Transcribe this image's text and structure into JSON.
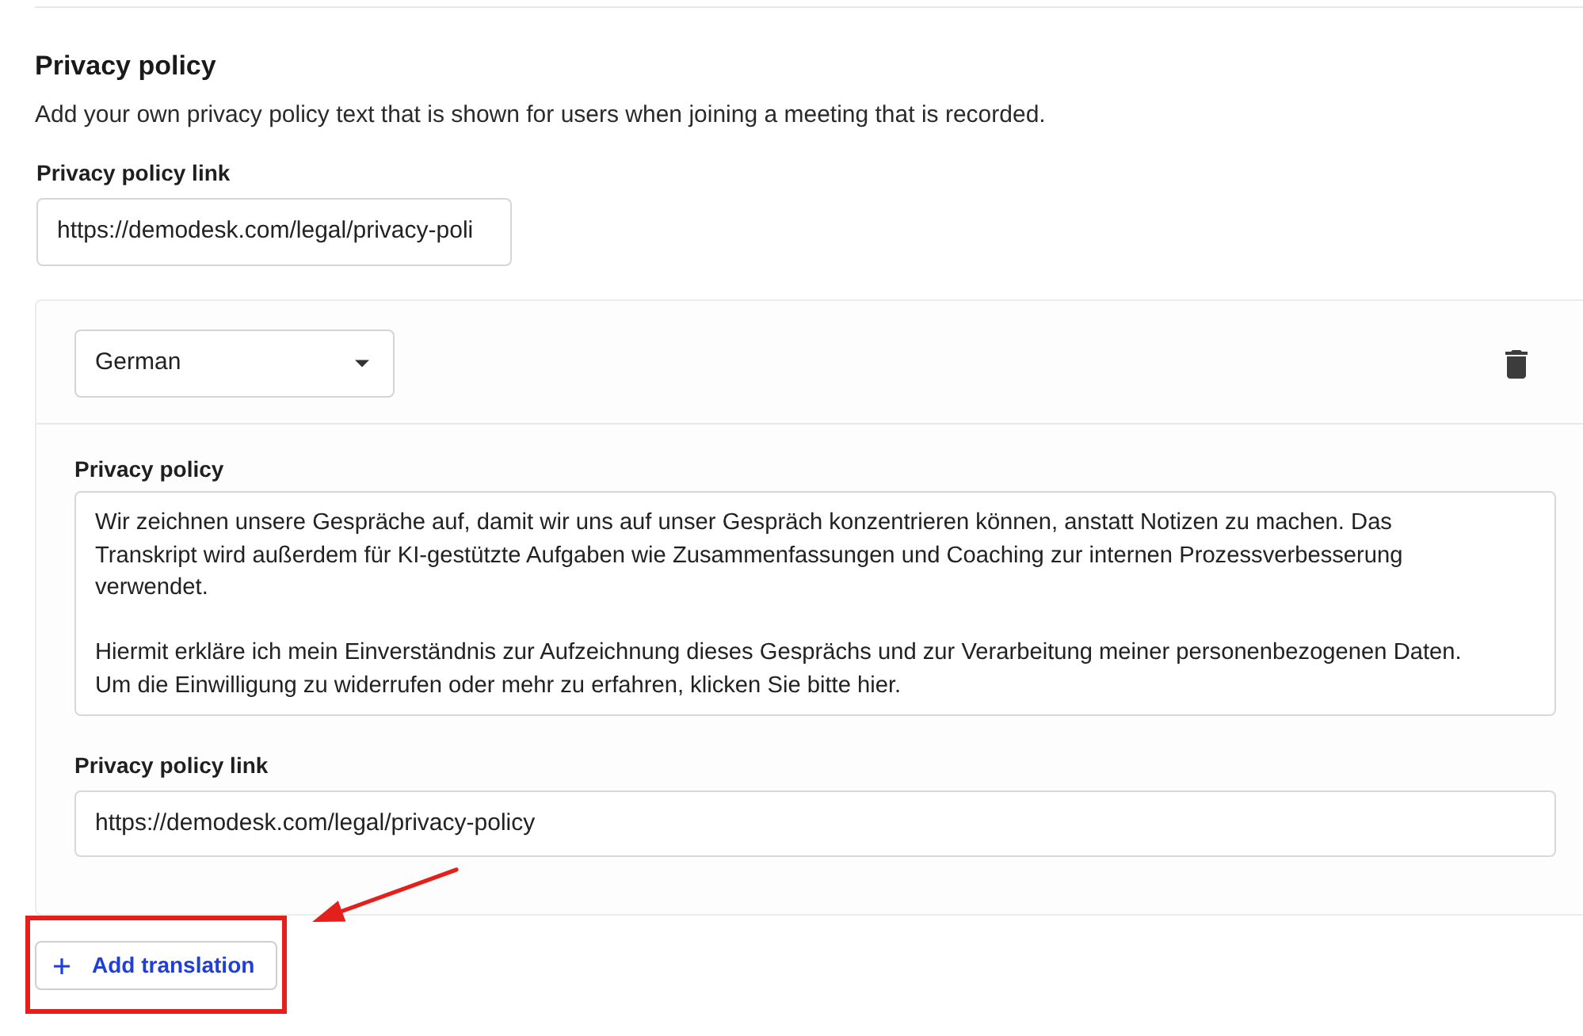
{
  "section": {
    "title": "Privacy policy",
    "description": "Add your own privacy policy text that is shown for users when joining a meeting that is recorded.",
    "link_field": {
      "label": "Privacy policy link",
      "value": "https://demodesk.com/legal/privacy-poli"
    }
  },
  "translations": [
    {
      "language": "German",
      "policy_field": {
        "label": "Privacy policy",
        "value": "Wir zeichnen unsere Gespräche auf, damit wir uns auf unser Gespräch konzentrieren können, anstatt Notizen zu machen. Das Transkript wird außerdem für KI-gestützte Aufgaben wie Zusammenfassungen und Coaching zur internen Prozessverbesserung verwendet.\n\nHiermit erkläre ich mein Einverständnis zur Aufzeichnung dieses Gesprächs und zur Verarbeitung meiner personenbezogenen Daten. Um die Einwilligung zu widerrufen oder mehr zu erfahren, klicken Sie bitte hier."
      },
      "link_field": {
        "label": "Privacy policy link",
        "value": "https://demodesk.com/legal/privacy-policy"
      }
    }
  ],
  "add_translation": {
    "label": "Add translation",
    "highlighted": true
  }
}
